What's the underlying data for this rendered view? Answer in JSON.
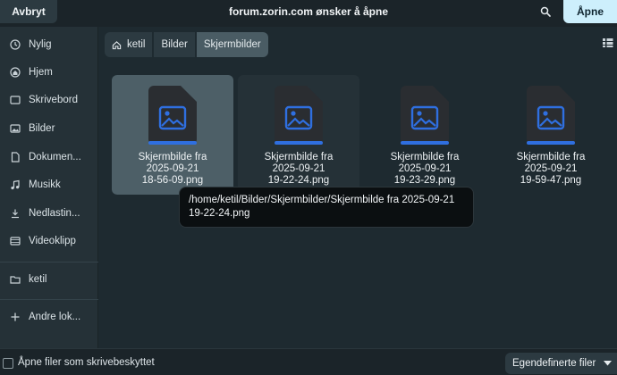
{
  "header": {
    "cancel_label": "Avbryt",
    "title": "forum.zorin.com ønsker å åpne",
    "open_label": "Åpne"
  },
  "sidebar": {
    "items": [
      {
        "label": "Nylig",
        "icon": "clock-icon"
      },
      {
        "label": "Hjem",
        "icon": "home-icon"
      },
      {
        "label": "Skrivebord",
        "icon": "desktop-icon"
      },
      {
        "label": "Bilder",
        "icon": "image-icon"
      },
      {
        "label": "Dokumen...",
        "icon": "document-icon"
      },
      {
        "label": "Musikk",
        "icon": "music-icon"
      },
      {
        "label": "Nedlastin...",
        "icon": "download-icon"
      },
      {
        "label": "Videoklipp",
        "icon": "video-icon"
      }
    ],
    "bookmarks": [
      {
        "label": "ketil",
        "icon": "folder-icon"
      }
    ],
    "other": {
      "label": "Andre lok...",
      "icon": "plus-icon"
    }
  },
  "breadcrumb": {
    "items": [
      "ketil",
      "Bilder",
      "Skjermbilder"
    ]
  },
  "files": [
    {
      "name": "Skjermbilde fra\n2025-09-21\n18-56-09.png",
      "icon": "image-file-icon",
      "state": "selected"
    },
    {
      "name": "Skjermbilde fra\n2025-09-21\n19-22-24.png",
      "icon": "image-file-icon",
      "state": "hover"
    },
    {
      "name": "Skjermbilde fra\n2025-09-21\n19-23-29.png",
      "icon": "image-file-icon",
      "state": "normal"
    },
    {
      "name": "Skjermbilde fra\n2025-09-21\n19-59-47.png",
      "icon": "image-file-icon",
      "state": "normal"
    }
  ],
  "tooltip": {
    "text": "/home/ketil/Bilder/Skjermbilder/Skjermbilde fra 2025-09-21\n19-22-24.png"
  },
  "footer": {
    "readonly_label": "Åpne filer som skrivebeskyttet",
    "readonly_checked": false,
    "filter_label": "Egendefinerte filer"
  },
  "colors": {
    "accent": "#cdeffc",
    "file_icon_blue": "#2f6fe0",
    "selected_bg": "#4d5f67"
  }
}
